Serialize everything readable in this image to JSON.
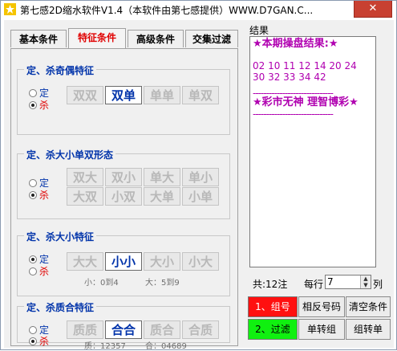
{
  "window": {
    "title": "第七感2D缩水软件V1.4（本软件由第七感提供）WWW.D7GAN.C...",
    "close_glyph": "✕"
  },
  "tabs": [
    {
      "label": "基本条件",
      "active": false
    },
    {
      "label": "特征条件",
      "active": true
    },
    {
      "label": "高级条件",
      "active": false
    },
    {
      "label": "交集过滤",
      "active": false
    }
  ],
  "groups": {
    "odd_even": {
      "title": "定、杀奇偶特征",
      "radio_keep": "定",
      "radio_kill": "杀",
      "selected": "kill",
      "buttons": [
        {
          "label": "双双",
          "selected": false
        },
        {
          "label": "双单",
          "selected": true
        },
        {
          "label": "单单",
          "selected": false
        },
        {
          "label": "单双",
          "selected": false
        }
      ]
    },
    "size_parity_form": {
      "title": "定、杀大小单双形态",
      "radio_keep": "定",
      "radio_kill": "杀",
      "selected": "kill",
      "buttons": [
        {
          "label": "双大",
          "selected": false
        },
        {
          "label": "双小",
          "selected": false
        },
        {
          "label": "单大",
          "selected": false
        },
        {
          "label": "单小",
          "selected": false
        },
        {
          "label": "大双",
          "selected": false
        },
        {
          "label": "小双",
          "selected": false
        },
        {
          "label": "大单",
          "selected": false
        },
        {
          "label": "小单",
          "selected": false
        }
      ]
    },
    "size": {
      "title": "定、杀大小特征",
      "radio_keep": "定",
      "radio_kill": "杀",
      "selected": "keep",
      "buttons": [
        {
          "label": "大大",
          "selected": false
        },
        {
          "label": "小小",
          "selected": true
        },
        {
          "label": "大小",
          "selected": false
        },
        {
          "label": "小大",
          "selected": false
        }
      ],
      "hint_small": "小：0到4",
      "hint_big": "大：5到9"
    },
    "prime_composite": {
      "title": "定、杀质合特征",
      "radio_keep": "定",
      "radio_kill": "杀",
      "selected": "kill",
      "buttons": [
        {
          "label": "质质",
          "selected": false
        },
        {
          "label": "合合",
          "selected": true
        },
        {
          "label": "质合",
          "selected": false
        },
        {
          "label": "合质",
          "selected": false
        }
      ],
      "hint_prime": "质：12357",
      "hint_composite": "合：04689"
    }
  },
  "results": {
    "label": "结果",
    "header": "★本期操盘结果:★",
    "numbers_row1": "02 10 11 12 14 20 24",
    "numbers_row2": "30 32 33 34 42",
    "divider": "------------------------------",
    "slogan": "★彩市无神 理智博彩★",
    "total": "共:12注",
    "per_row_label": "每行",
    "per_row_value": "7",
    "per_row_unit": "列"
  },
  "actions": {
    "group_btn": "1、组号",
    "reverse_btn": "相反号码",
    "clear_btn": "清空条件",
    "filter_btn": "2、过滤",
    "single_to_group_btn": "单转组",
    "group_to_single_btn": "组转单"
  },
  "colors": {
    "accent_blue": "#0033aa",
    "active_tab_red": "#e00000",
    "result_magenta": "#b000b0",
    "btn_red": "#ff1010",
    "btn_green": "#10f010"
  }
}
